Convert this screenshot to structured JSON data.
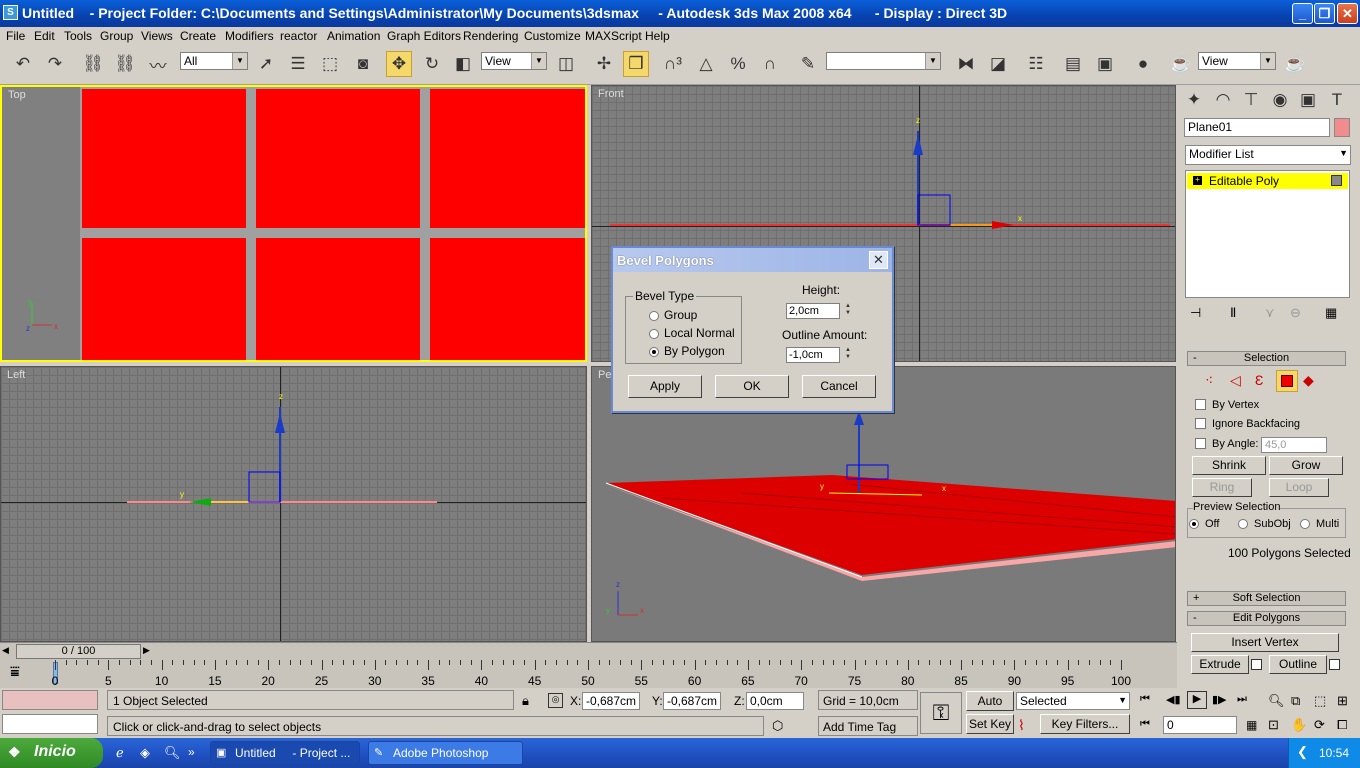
{
  "window": {
    "title": "Untitled    - Project Folder: C:\\Documents and Settings\\Administrator\\My Documents\\3dsmax     - Autodesk 3ds Max 2008 x64      - Display : Direct 3D"
  },
  "menu": [
    "File",
    "Edit",
    "Tools",
    "Group",
    "Views",
    "Create",
    "Modifiers",
    "reactor",
    "Animation",
    "Graph Editors",
    "Rendering",
    "Customize",
    "MAXScript",
    "Help"
  ],
  "toolbar": {
    "selection_filter": "All",
    "ref_coord": "View",
    "named_selection": "",
    "render_view": "View"
  },
  "viewports": {
    "top": "Top",
    "front": "Front",
    "left": "Left",
    "perspective": "Pers"
  },
  "dialog": {
    "title": "Bevel Polygons",
    "bevel_type_label": "Bevel Type",
    "options": [
      "Group",
      "Local Normal",
      "By Polygon"
    ],
    "selected_option": "By Polygon",
    "height_label": "Height:",
    "height_value": "2,0cm",
    "outline_label": "Outline Amount:",
    "outline_value": "-1,0cm",
    "apply": "Apply",
    "ok": "OK",
    "cancel": "Cancel"
  },
  "command_panel": {
    "object_name": "Plane01",
    "object_color": "#f08c8c",
    "modifier_list": "Modifier List",
    "stack_item": "Editable Poly",
    "selection_title": "Selection",
    "by_vertex": "By Vertex",
    "ignore_backfacing": "Ignore Backfacing",
    "by_angle": "By Angle:",
    "angle_value": "45,0",
    "shrink": "Shrink",
    "grow": "Grow",
    "ring": "Ring",
    "loop": "Loop",
    "preview_selection": "Preview Selection",
    "preview_off": "Off",
    "preview_subobj": "SubObj",
    "preview_multi": "Multi",
    "selected_count": "100 Polygons Selected",
    "soft_selection": "Soft Selection",
    "edit_polygons": "Edit Polygons",
    "insert_vertex": "Insert Vertex",
    "extrude": "Extrude",
    "outline": "Outline"
  },
  "timeline": {
    "frame_display": "0 / 100",
    "ticks": [
      "0",
      "5",
      "10",
      "15",
      "20",
      "25",
      "30",
      "35",
      "40",
      "45",
      "50",
      "55",
      "60",
      "65",
      "70",
      "75",
      "80",
      "85",
      "90",
      "95",
      "100"
    ]
  },
  "status": {
    "selection": "1 Object Selected",
    "prompt": "Click or click-and-drag to select objects",
    "x_label": "X:",
    "x_value": "-0,687cm",
    "y_label": "Y:",
    "y_value": "-0,687cm",
    "z_label": "Z:",
    "z_value": "0,0cm",
    "grid": "Grid = 10,0cm",
    "add_time_tag": "Add Time Tag",
    "auto_key": "Auto Key",
    "set_key": "Set Key",
    "key_mode": "Selected",
    "key_filters": "Key Filters...",
    "frame": "0"
  },
  "taskbar": {
    "start": "Inicio",
    "task1": "Untitled     - Project ...",
    "task2": "Adobe Photoshop",
    "clock": "10:54"
  },
  "colors": {
    "polygon_red": "#ff0000",
    "selection_yellow": "#ffff00"
  }
}
